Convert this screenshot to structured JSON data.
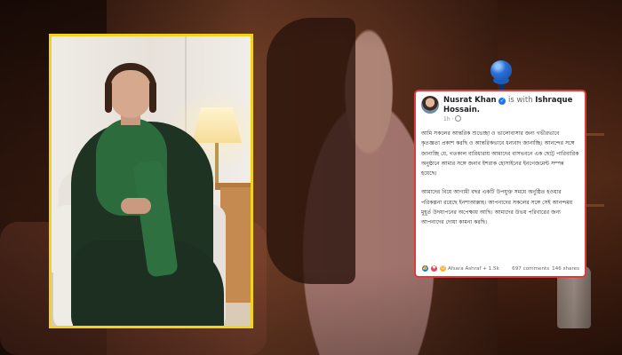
{
  "post": {
    "author": "Nusrat Khan",
    "with_prefix": "is with",
    "tagged": "Ishraque Hossain.",
    "time": "1h ·",
    "paragraph_1": "আমি সকলের আন্তরিক শুভেচ্ছা ও ভালোবাসার জন্য গভীরভাবে কৃতজ্ঞতা প্রকাশ করছি ও আন্তরিকভাবে ধন্যবাদ জানাচ্ছি। আনন্দের সঙ্গে জানাচ্ছি যে, গতকাল বারিধারায় আমাদের বাসভবনে এক ছোট্ট পারিবারিক অনুষ্ঠানে আমার সঙ্গে জনাব ইশরাক হোসাইনের ইনগেজমেন্ট সম্পন্ন হয়েছে।",
    "paragraph_2": "আমাদের বিয়ে আগামী বছর একটি উপযুক্ত সময়ে অনুষ্ঠিত হওয়ার পরিকল্পনা রয়েছে ইনশাআল্লাহ। আপনাদের সকলের সঙ্গে সেই আনন্দময় মুহূর্ত উদযাপনের অপেক্ষায় আছি। আমাদের উভয় পরিবারের জন্য আপনাদের দোয়া কামনা করছি।",
    "reactions_text": "Afsara Ashraf + 1.5k",
    "comments": "697 comments",
    "shares": "146 shares"
  },
  "icons": {
    "verified": "verified-badge-icon",
    "globe": "globe-icon",
    "like": "like-reaction-icon",
    "love": "love-reaction-icon",
    "care": "care-reaction-icon",
    "pin": "pushpin-icon"
  },
  "colors": {
    "video_border": "#f2d21a",
    "card_border": "#e03b3b",
    "pin": "#2a6fd6",
    "facebook_blue": "#1877f2"
  }
}
